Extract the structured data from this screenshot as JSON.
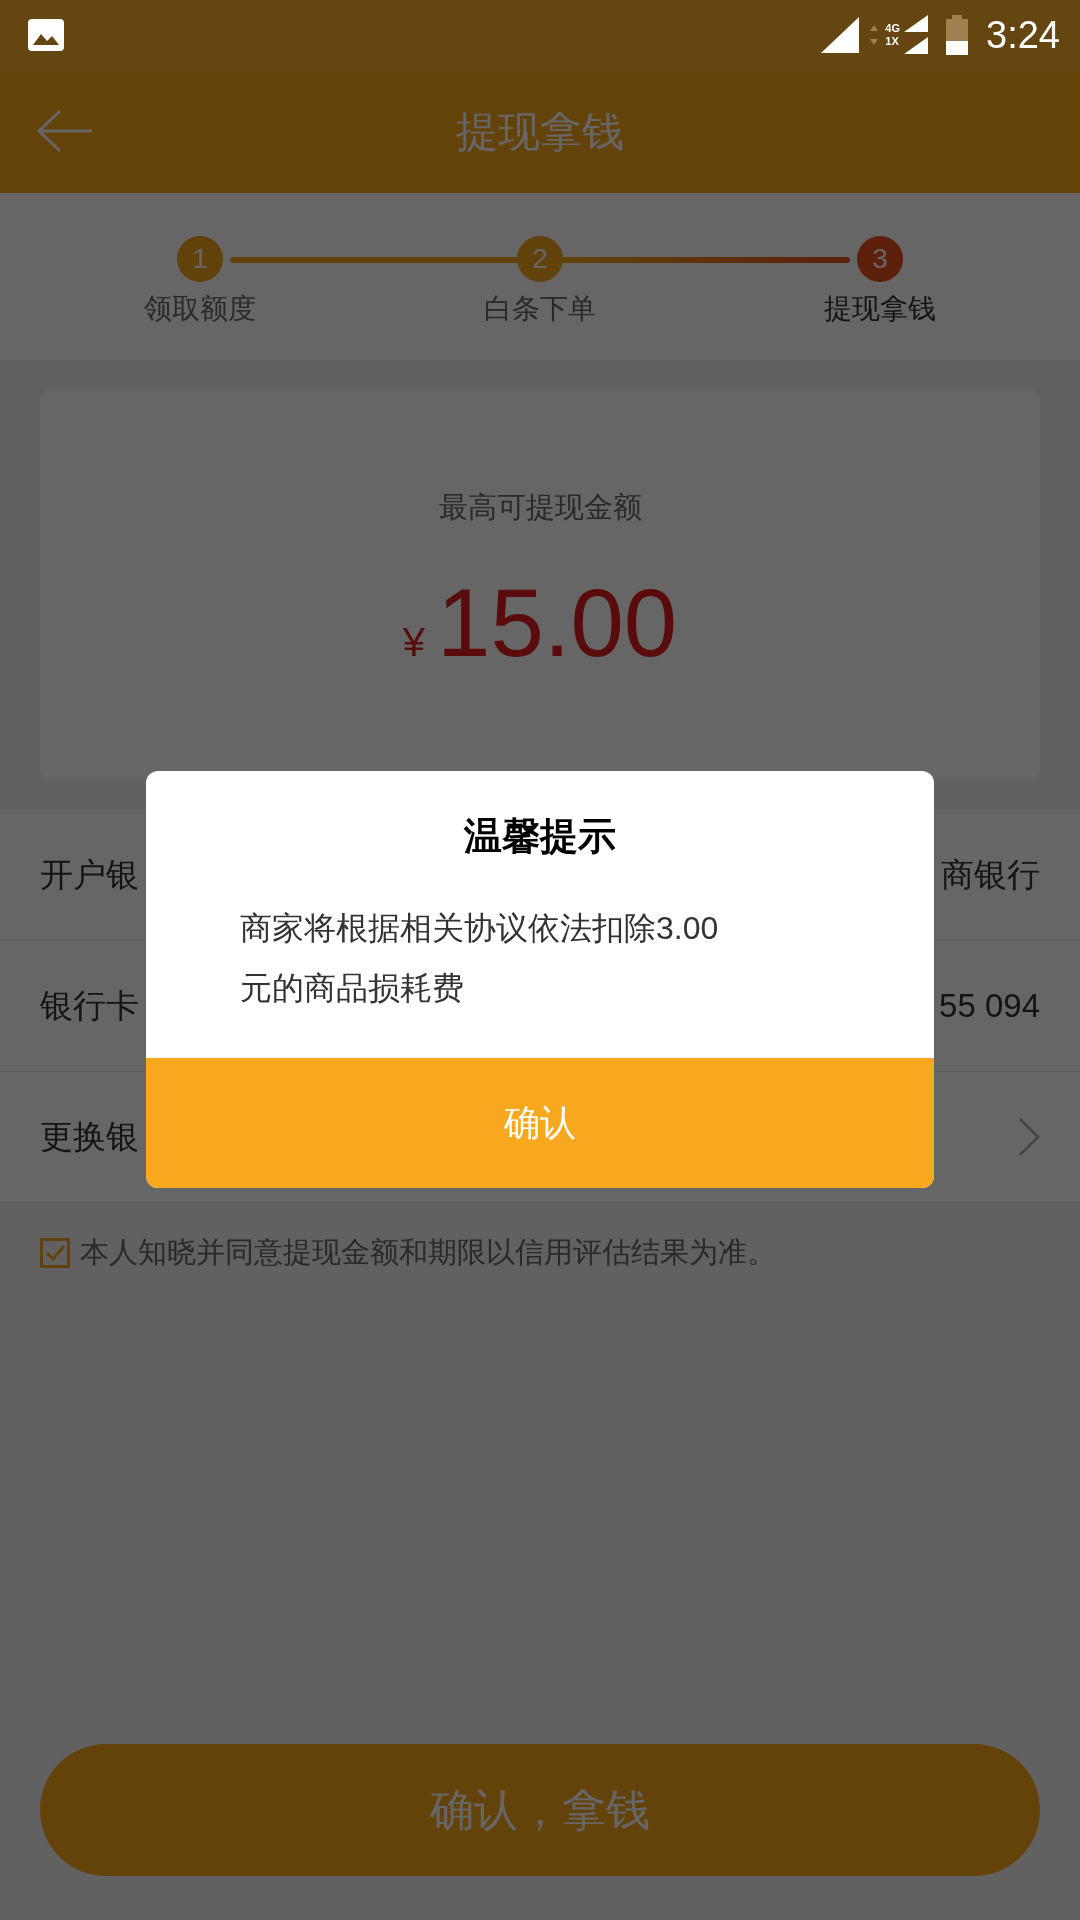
{
  "status_bar": {
    "time": "3:24",
    "network": "4G",
    "network_2": "1X"
  },
  "header": {
    "title": "提现拿钱"
  },
  "steps": [
    {
      "number": "1",
      "label": "领取额度",
      "selected": false
    },
    {
      "number": "2",
      "label": "白条下单",
      "selected": false
    },
    {
      "number": "3",
      "label": "提现拿钱",
      "selected": true
    }
  ],
  "amount_card": {
    "label": "最高可提现金额",
    "currency": "¥",
    "amount": "15.00"
  },
  "rows": [
    {
      "label": "开户银",
      "value": "商银行",
      "kind": "text"
    },
    {
      "label": "银行卡",
      "value": "55 094",
      "kind": "text"
    },
    {
      "label": "更换银",
      "kind": "link"
    }
  ],
  "agreement": {
    "text": "本人知晓并同意提现金额和期限以信用评估结果为准。",
    "checked": true
  },
  "submit_button": "确认，拿钱",
  "dialog": {
    "title": "温馨提示",
    "message": "商家将根据相关协议依法扣除3.00元的商品损耗费",
    "button": "确认"
  }
}
